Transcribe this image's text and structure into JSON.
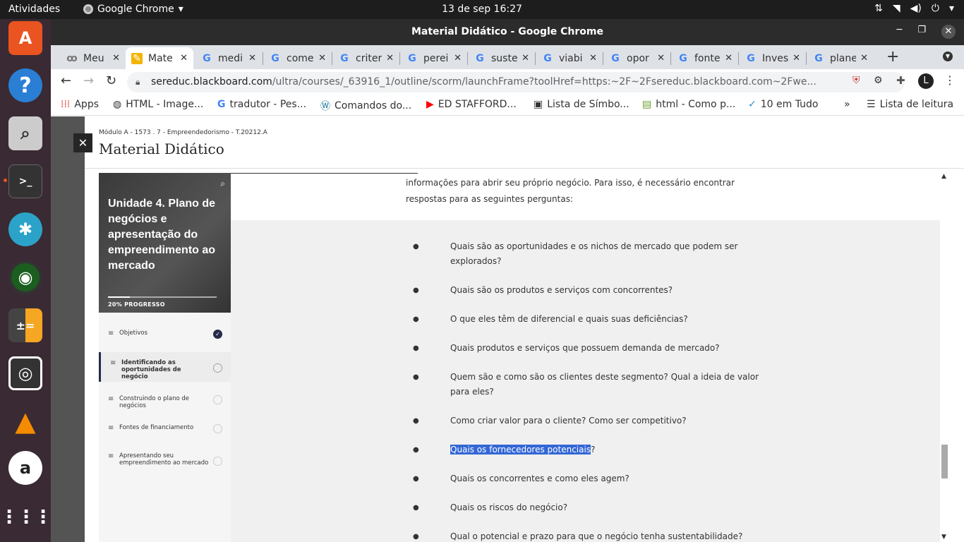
{
  "topbar": {
    "activities": "Atividades",
    "app": "Google Chrome",
    "clock": "13 de sep  16:27"
  },
  "window": {
    "title": "Material Didático - Google Chrome"
  },
  "tabs": [
    {
      "label": "Meu",
      "icon": "blackboard-icon"
    },
    {
      "label": "Mate",
      "icon": "pencil-icon",
      "active": true
    },
    {
      "label": "medi",
      "icon": "google-icon"
    },
    {
      "label": "come",
      "icon": "google-icon"
    },
    {
      "label": "criter",
      "icon": "google-icon"
    },
    {
      "label": "perei",
      "icon": "google-icon"
    },
    {
      "label": "suste",
      "icon": "google-icon"
    },
    {
      "label": "viabi",
      "icon": "google-icon"
    },
    {
      "label": "opor",
      "icon": "google-icon"
    },
    {
      "label": "fonte",
      "icon": "google-icon"
    },
    {
      "label": "Inves",
      "icon": "google-icon"
    },
    {
      "label": "plane",
      "icon": "google-icon"
    }
  ],
  "address": {
    "host": "sereduc.blackboard.com",
    "path": "/ultra/courses/_63916_1/outline/scorm/launchFrame?toolHref=https:~2F~2Fsereduc.blackboard.com~2Fwe..."
  },
  "bookmarks": [
    {
      "label": "Apps"
    },
    {
      "label": "HTML - Image..."
    },
    {
      "label": "tradutor - Pes..."
    },
    {
      "label": "Comandos do..."
    },
    {
      "label": "ED STAFFORD..."
    },
    {
      "label": "Lista de Símbo..."
    },
    {
      "label": "html - Como p..."
    },
    {
      "label": "10 em Tudo"
    }
  ],
  "bookmarks_more": "»",
  "reading_list": "Lista de leitura",
  "panel": {
    "crumb": "Módulo A - 1573 . 7 - Empreendedorismo - T.20212.A",
    "title": "Material Didático",
    "close": "✕"
  },
  "sidebar": {
    "unit_title": "Unidade 4. Plano de negócios e apresentação do empreendimento ao mercado",
    "progress_label": "20% PROGRESSO",
    "progress": 0.2,
    "items": [
      {
        "label": "Objetivos",
        "state": "done"
      },
      {
        "label": "Identificando as oportunidades de negócio",
        "state": "current"
      },
      {
        "label": "Construindo o plano de negócios",
        "state": "todo"
      },
      {
        "label": "Fontes de financiamento",
        "state": "todo"
      },
      {
        "label": "Apresentando seu empreendimento ao mercado",
        "state": "todo"
      }
    ]
  },
  "content": {
    "intro": "informações para abrir seu próprio negócio. Para isso, é necessário encontrar respostas para as seguintes perguntas:",
    "bullets": [
      "Quais são as oportunidades e os nichos de mercado que podem ser explorados?",
      "Quais são os produtos e serviços com concorrentes?",
      "O que eles têm de diferencial e quais suas deficiências?",
      "Quais produtos e serviços que possuem demanda de mercado?",
      "Quem são e como são os clientes deste segmento? Qual a ideia de valor para eles?",
      "Como criar valor para o cliente? Como ser competitivo?",
      "Quais os fornecedores potenciais?",
      "Quais os concorrentes e como eles agem?",
      "Quais os riscos do negócio?",
      "Qual o potencial e prazo para que o negócio tenha sustentabilidade?"
    ],
    "highlight_text": "Quais os fornecedores potenciais",
    "highlight_rest": "?"
  }
}
